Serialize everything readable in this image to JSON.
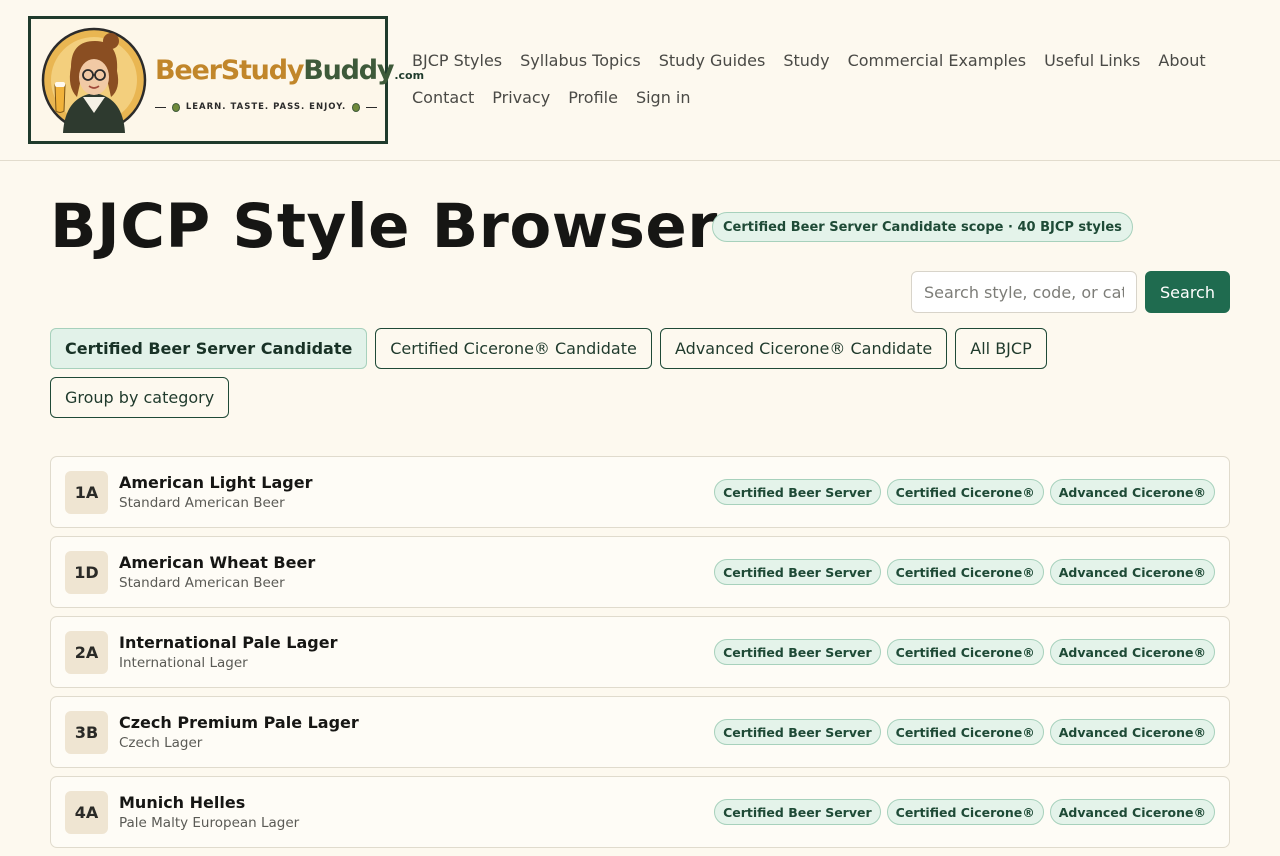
{
  "header": {
    "logo": {
      "word1": "Beer",
      "word2": "Study",
      "word3": "Buddy",
      "dotcom": ".com",
      "tagline": "LEARN. TASTE. PASS. ENJOY."
    },
    "nav": [
      {
        "label": "BJCP Styles"
      },
      {
        "label": "Syllabus Topics"
      },
      {
        "label": "Study Guides"
      },
      {
        "label": "Study"
      },
      {
        "label": "Commercial Examples"
      },
      {
        "label": "Useful Links"
      },
      {
        "label": "About"
      },
      {
        "label": "Contact"
      },
      {
        "label": "Privacy"
      },
      {
        "label": "Profile"
      },
      {
        "label": "Sign in"
      }
    ]
  },
  "main": {
    "title": "BJCP Style Browser",
    "scope_badge": "Certified Beer Server Candidate scope · 40 BJCP styles",
    "search": {
      "placeholder": "Search style, code, or category",
      "button_label": "Search"
    },
    "filters": [
      {
        "label": "Certified Beer Server Candidate",
        "active": true
      },
      {
        "label": "Certified Cicerone® Candidate",
        "active": false
      },
      {
        "label": "Advanced Cicerone® Candidate",
        "active": false
      },
      {
        "label": "All BJCP",
        "active": false
      },
      {
        "label": "Group by category",
        "active": false
      }
    ],
    "styles": [
      {
        "code": "1A",
        "name": "American Light Lager",
        "category": "Standard American Beer",
        "certs": [
          "Certified Beer Server",
          "Certified Cicerone®",
          "Advanced Cicerone®"
        ]
      },
      {
        "code": "1D",
        "name": "American Wheat Beer",
        "category": "Standard American Beer",
        "certs": [
          "Certified Beer Server",
          "Certified Cicerone®",
          "Advanced Cicerone®"
        ]
      },
      {
        "code": "2A",
        "name": "International Pale Lager",
        "category": "International Lager",
        "certs": [
          "Certified Beer Server",
          "Certified Cicerone®",
          "Advanced Cicerone®"
        ]
      },
      {
        "code": "3B",
        "name": "Czech Premium Pale Lager",
        "category": "Czech Lager",
        "certs": [
          "Certified Beer Server",
          "Certified Cicerone®",
          "Advanced Cicerone®"
        ]
      },
      {
        "code": "4A",
        "name": "Munich Helles",
        "category": "Pale Malty European Lager",
        "certs": [
          "Certified Beer Server",
          "Certified Cicerone®",
          "Advanced Cicerone®"
        ]
      }
    ]
  }
}
